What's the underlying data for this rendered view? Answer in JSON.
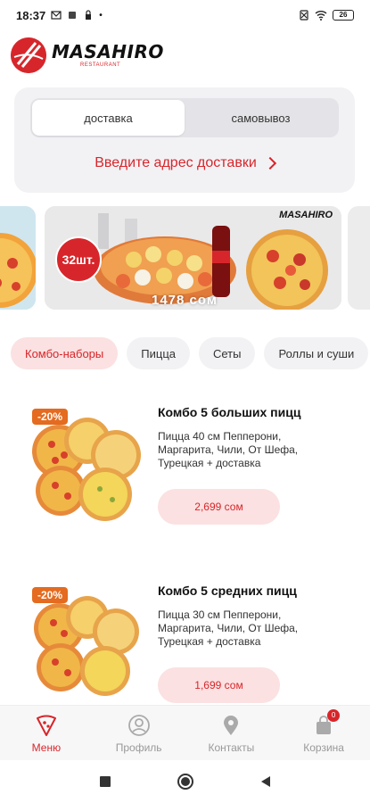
{
  "status_bar": {
    "time": "18:37",
    "battery": "26"
  },
  "brand": {
    "name": "MASAHIRO",
    "sub": "RESTAURANT"
  },
  "delivery": {
    "tabs": [
      {
        "label": "доставка",
        "active": true
      },
      {
        "label": "самовывоз",
        "active": false
      }
    ],
    "address_prompt": "Введите адрес доставки"
  },
  "banner": {
    "count_badge": "32шт.",
    "price": "1478 сом",
    "brand": "MASAHIRO"
  },
  "categories": [
    {
      "label": "Комбо-наборы",
      "active": true
    },
    {
      "label": "Пицца",
      "active": false
    },
    {
      "label": "Сеты",
      "active": false
    },
    {
      "label": "Роллы и суши",
      "active": false
    }
  ],
  "products": [
    {
      "discount": "-20%",
      "title": "Комбо 5 больших пицц",
      "description": "Пицца 40 см Пепперони, Маргарита, Чили, От Шефа, Турецкая  + доставка",
      "price": "2,699 сом"
    },
    {
      "discount": "-20%",
      "title": "Комбо 5 средних пицц",
      "description": "Пицца 30 см Пепперони, Маргарита, Чили, От Шефа, Турецкая + доставка",
      "price": "1,699 сом"
    }
  ],
  "bottom_nav": [
    {
      "label": "Меню",
      "icon": "pizza-slice-icon",
      "active": true
    },
    {
      "label": "Профиль",
      "icon": "user-icon",
      "active": false
    },
    {
      "label": "Контакты",
      "icon": "location-pin-icon",
      "active": false
    },
    {
      "label": "Корзина",
      "icon": "shopping-bag-icon",
      "active": false,
      "badge": "0"
    }
  ],
  "colors": {
    "accent": "#d7262b",
    "chip_active_bg": "#fbe1e1",
    "discount": "#e46b1f"
  }
}
